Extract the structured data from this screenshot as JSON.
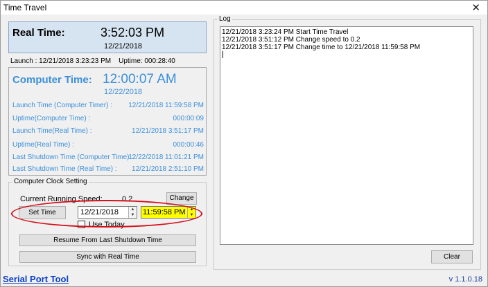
{
  "window": {
    "title": "Time Travel",
    "close_glyph": "✕"
  },
  "real_time": {
    "label": "Real Time:",
    "time": "3:52:03 PM",
    "date": "12/21/2018"
  },
  "launch_info": {
    "launch": "Launch : 12/21/2018 3:23:23 PM",
    "uptime": "Uptime: 000:28:40"
  },
  "computer_time": {
    "label": "Computer Time:",
    "time": "12:00:07 AM",
    "date": "12/22/2018",
    "accent_color": "#3b8fdb",
    "rows": [
      {
        "key": "Launch Time (Computer Timer) :",
        "value": "12/21/2018 11:59:58 PM"
      },
      {
        "key": "Uptime(Computer Time) :",
        "value": "000:00:09"
      },
      {
        "key": "Launch Time(Real Time) :",
        "value": "12/21/2018 3:51:17 PM"
      },
      {
        "key": "Uptime(Real Time) :",
        "value": "000:00:46"
      },
      {
        "key": "Last Shutdown Time (Computer Time) :",
        "value": "12/22/2018 11:01:21 PM"
      },
      {
        "key": "Last Shutdown Time (Real Time) :",
        "value": "12/21/2018 2:51:10 PM"
      }
    ]
  },
  "clock_setting": {
    "legend": "Computer Clock Setting",
    "speed_label": "Current Running Speed:",
    "speed_value": "0.2",
    "change_label": "Change",
    "set_time_label": "Set Time",
    "date_value": "12/21/2018",
    "time_value": "11:59:58 PM",
    "time_highlight_color": "#ffff00",
    "use_today_label": "Use Today",
    "use_today_checked": false,
    "resume_label": "Resume From Last Shutdown Time",
    "sync_label": "Sync with Real Time",
    "annotation_color": "#d4101a"
  },
  "log": {
    "legend": "Log",
    "lines": [
      "12/21/2018 3:23:24 PM  Start Time Travel",
      "12/21/2018 3:51:12 PM  Change speed to 0.2",
      "12/21/2018 3:51:17 PM  Change time to 12/21/2018 11:59:58 PM"
    ],
    "clear_label": "Clear"
  },
  "footer": {
    "link_text": "Serial Port Tool",
    "version": "v 1.1.0.18"
  },
  "icons": {
    "spin_up": "▲",
    "spin_down": "▼"
  }
}
